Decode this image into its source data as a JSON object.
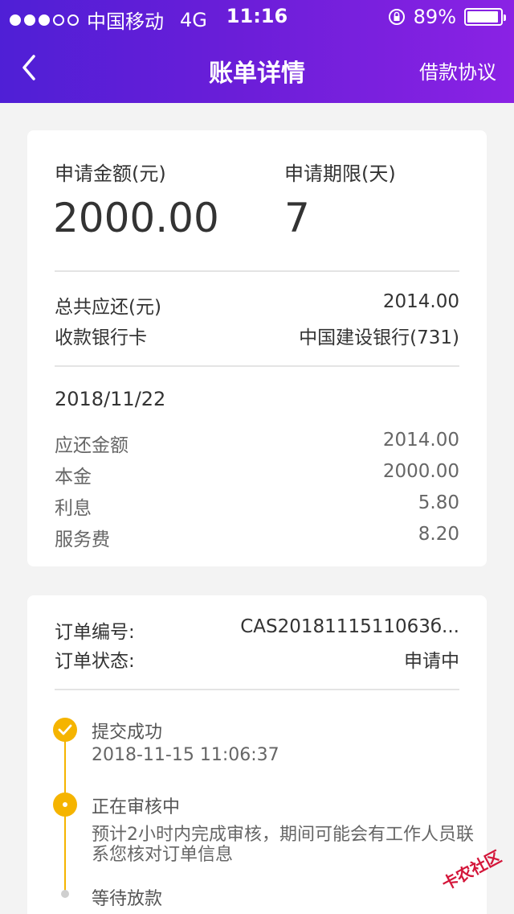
{
  "status_bar": {
    "carrier": "中国移动",
    "network": "4G",
    "time": "11:16",
    "battery": "89%"
  },
  "nav": {
    "title": "账单详情",
    "agreement_label": "借款协议"
  },
  "loan": {
    "amount_label": "申请金额(元)",
    "amount_value": "2000.00",
    "term_label": "申请期限(天)",
    "term_value": "7",
    "total_repay_label": "总共应还(元)",
    "total_repay_value": "2014.00",
    "bank_card_label": "收款银行卡",
    "bank_card_value": "中国建设银行(731)",
    "due_date": "2018/11/22",
    "breakdown": [
      {
        "label": "应还金额",
        "value": "2014.00"
      },
      {
        "label": "本金",
        "value": "2000.00"
      },
      {
        "label": "利息",
        "value": "5.80"
      },
      {
        "label": "服务费",
        "value": "8.20"
      }
    ]
  },
  "order": {
    "number_label": "订单编号:",
    "number_value": "CAS2018111511063б...",
    "status_label": "订单状态:",
    "status_value": "申请中",
    "timeline": [
      {
        "title": "提交成功",
        "detail": "2018-11-15 11:06:37"
      },
      {
        "title": "正在审核中",
        "detail_line1": "预计2小时内完成审核，期间可能会有工作人员联",
        "detail_line2": "系您核对订单信息"
      },
      {
        "title": "等待放款"
      }
    ]
  },
  "watermark": {
    "text": "卡农社区"
  },
  "colors": {
    "header_gradient_start": "#4f1fd6",
    "header_gradient_end": "#8a22e4",
    "timeline_accent": "#f5b400",
    "background": "#f3f3f3"
  }
}
